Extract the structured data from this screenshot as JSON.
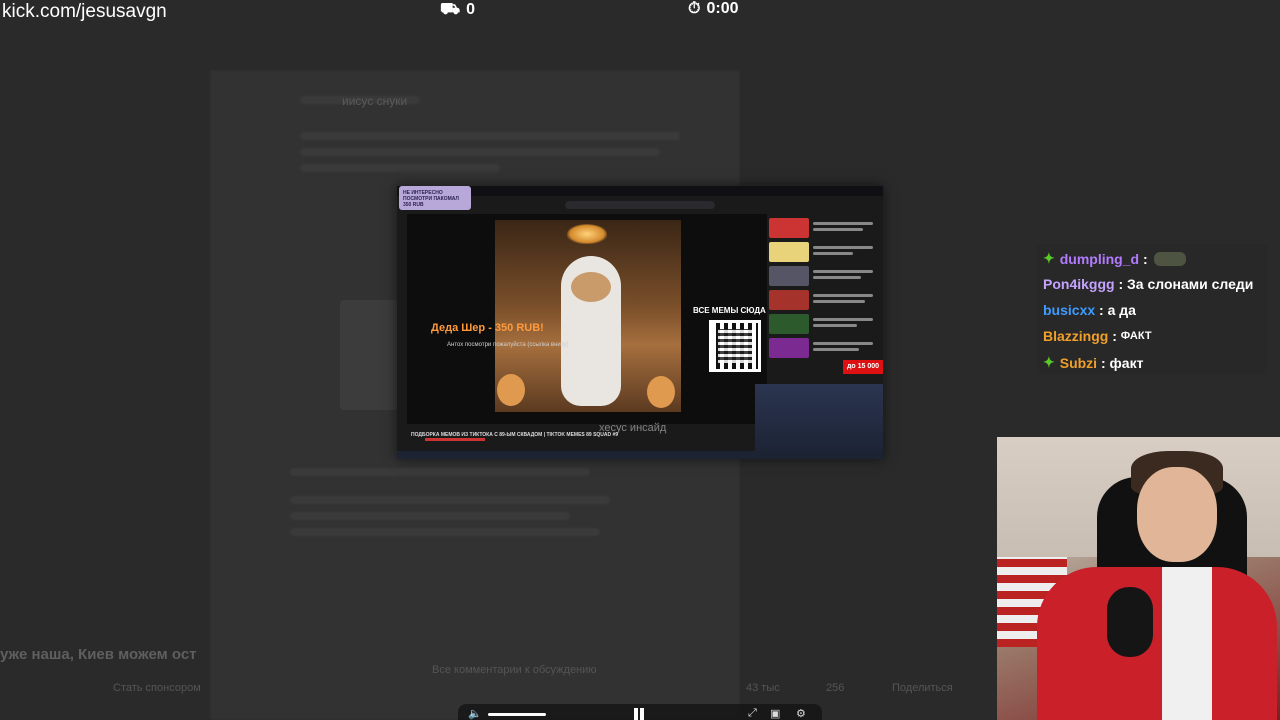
{
  "topbar": {
    "url": "kick.com/jesusavgn",
    "viewers_icon": "chair-icon",
    "viewers": "0",
    "timer_icon": "stopwatch-icon",
    "timer": "0:00"
  },
  "video": {
    "sticker_text": "НЕ ИНТЕРЕСНО ПОСМОТРИ ПАКОМАЛ 350 RUB",
    "overlay_title": "Деда Шер - 350 RUB!",
    "overlay_sub": "Антох посмотри пожалуйста (ссылка внизу)",
    "memes_label": "ВСЕ МЕМЫ СЮДА",
    "price_badge": "до 15 000",
    "caption": "ПОДБОРКА МЕМОВ ИЗ ТИКТОКА С 89-ЫМ СКВАДОМ | TIKTOK MEMES 89 SQUAD #9",
    "watermark": "хесус инсайд"
  },
  "chat": [
    {
      "user": "dumpling_d",
      "color": "#b27bff",
      "badge": true,
      "text": "",
      "emote": true
    },
    {
      "user": "Pon4ikggg",
      "color": "#c4a3ff",
      "badge": false,
      "text": "За слонами следи",
      "emote": false
    },
    {
      "user": "busicxx",
      "color": "#3f9cff",
      "badge": false,
      "text": "а да",
      "emote": false
    },
    {
      "user": "Blazzingg",
      "color": "#f0a02a",
      "badge": false,
      "text": "ФАКТ",
      "emote": false
    },
    {
      "user": "Subzi",
      "color": "#f0a02a",
      "badge": true,
      "text": "факт",
      "emote": false
    }
  ],
  "background": {
    "headline": "уже наша, Киев можем ост",
    "follow": "Стать спонсором",
    "views": "43 тыс",
    "likes": "256",
    "share": "Поделиться",
    "comments_link": "Все комментарии к обсуждению",
    "author": "иисус снуки"
  },
  "player": {
    "volume_icon": "speaker-icon",
    "pause_icon": "pause-icon",
    "expand_icon": "expand-icon",
    "pip_icon": "pip-icon",
    "settings_icon": "gear-icon"
  }
}
